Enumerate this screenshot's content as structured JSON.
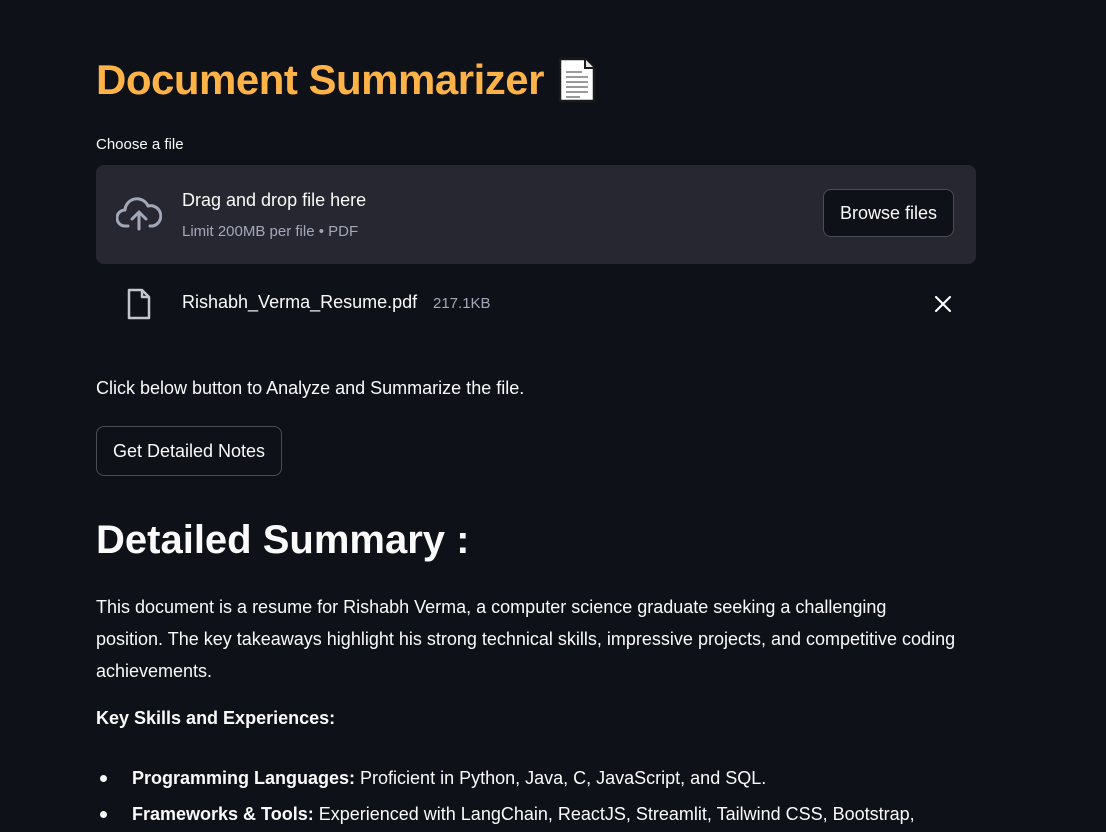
{
  "page": {
    "title": "Document Summarizer",
    "title_icon": "page-facing-up-icon",
    "accent_color": "#ffb347",
    "background_color": "#0e1117"
  },
  "uploader": {
    "label": "Choose a file",
    "drop_text": "Drag and drop file here",
    "limit_text": "Limit 200MB per file • PDF",
    "browse_label": "Browse files",
    "icon": "cloud-upload-icon"
  },
  "uploaded_file": {
    "name": "Rishabh_Verma_Resume.pdf",
    "size": "217.1KB",
    "icon": "file-icon",
    "remove_icon": "close-icon"
  },
  "actions": {
    "instruction": "Click below button to Analyze and Summarize the file.",
    "notes_button_label": "Get Detailed Notes"
  },
  "summary": {
    "heading": "Detailed Summary :",
    "paragraph": "This document is a resume for Rishabh Verma, a computer science graduate seeking a challenging position. The key takeaways highlight his strong technical skills, impressive projects, and competitive coding achievements.",
    "skills_heading": "Key Skills and Experiences:",
    "skills": [
      {
        "label": "Programming Languages:",
        "text": " Proficient in Python, Java, C, JavaScript, and SQL."
      },
      {
        "label": "Frameworks & Tools:",
        "text": " Experienced with LangChain, ReactJS, Streamlit, Tailwind CSS, Bootstrap,"
      }
    ]
  }
}
